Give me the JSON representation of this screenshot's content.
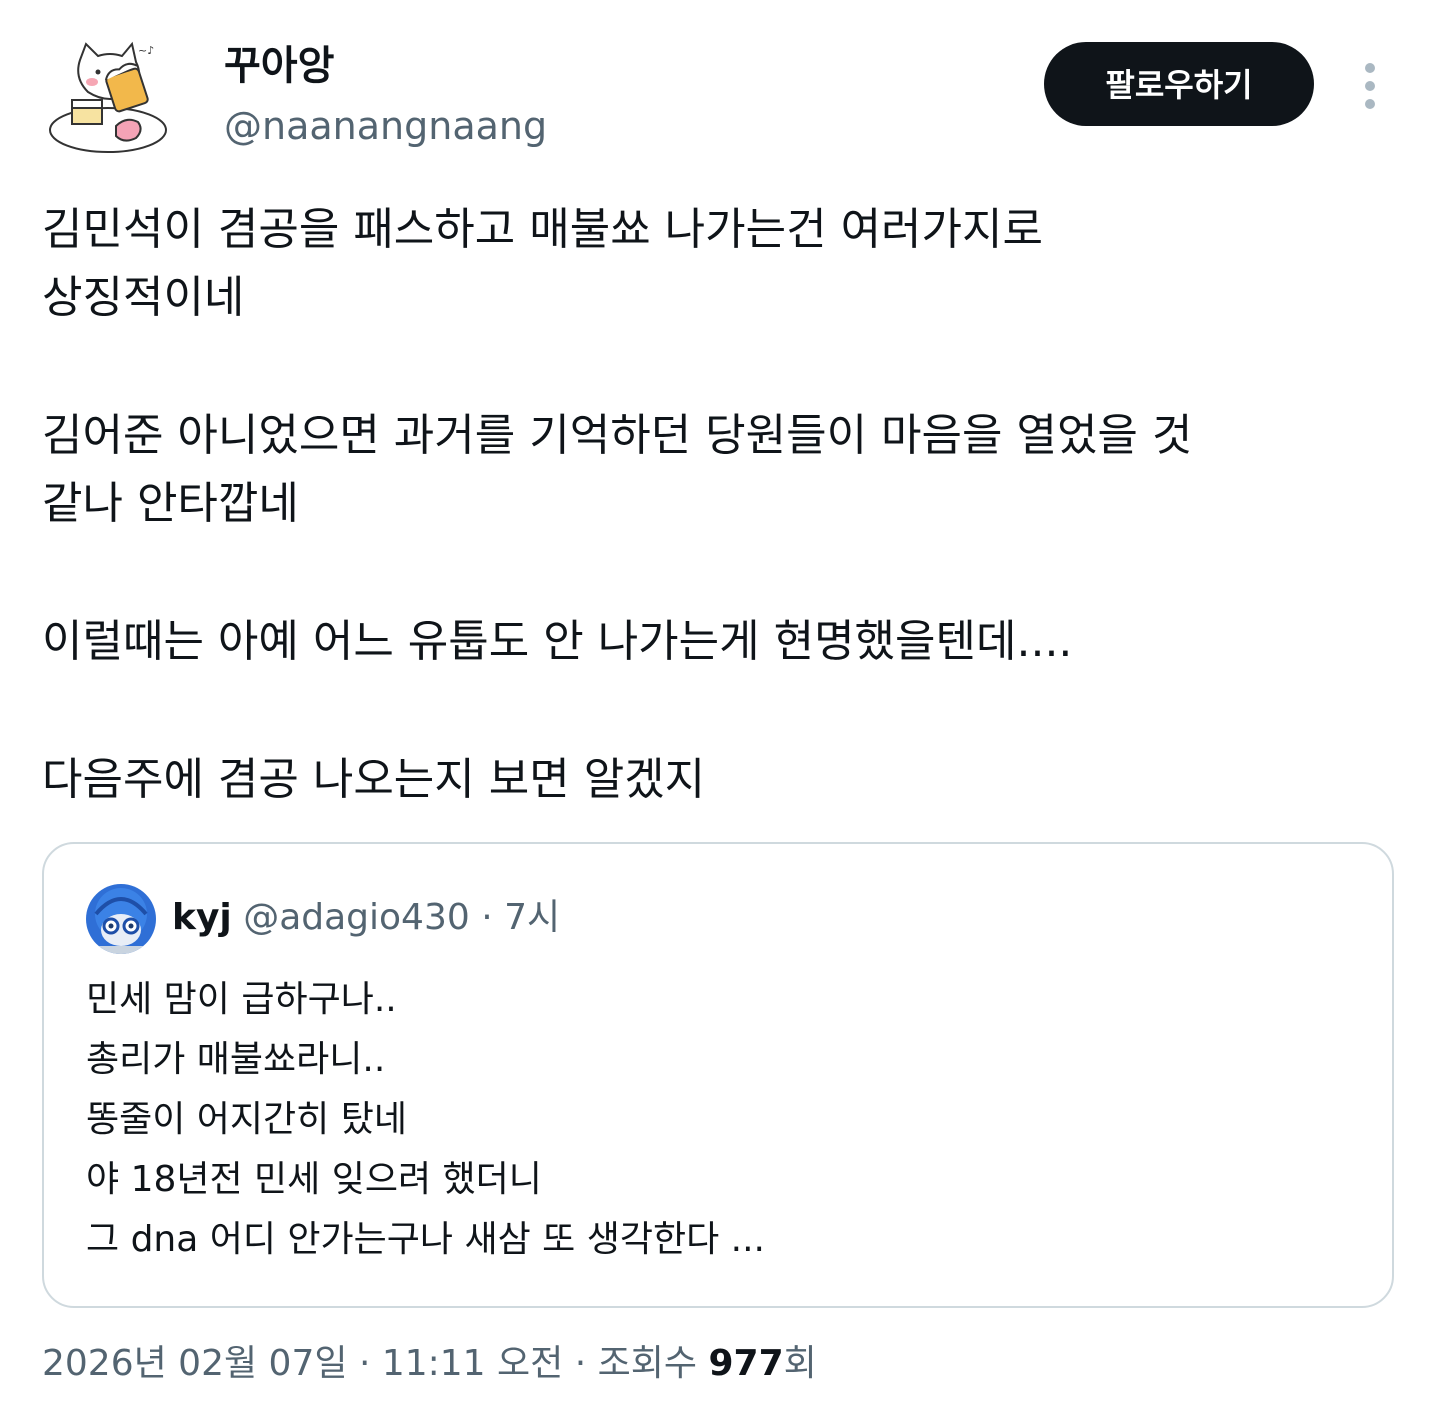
{
  "author": {
    "display_name": "꾸아앙",
    "handle": "@naanangnaang"
  },
  "header": {
    "follow_label": "팔로우하기",
    "more_icon": "more-vertical-icon"
  },
  "tweet": {
    "paragraphs": [
      [
        "김민석이 겸공을 패스하고 매불쑈 나가는건 여러가지로",
        "상징적이네"
      ],
      [
        "김어준 아니었으면 과거를 기억하던 당원들이 마음을 열었을 것",
        "같나 안타깝네"
      ],
      [
        "이럴때는 아예 어느 유툽도 안 나가는게 현명했을텐데...."
      ],
      [
        "다음주에 겸공 나오는지 보면 알겠지"
      ]
    ]
  },
  "quote": {
    "name": "kyj",
    "handle": "@adagio430",
    "separator": "·",
    "time": "7시",
    "lines": [
      "민세  맘이 급하구나..",
      "총리가  매불쑈라니..",
      "똥줄이 어지간히 탔네",
      "야  18년전 민세 잊으려 했더니",
      "그 dna 어디 안가는구나 새삼 또 생각한다 ..."
    ]
  },
  "meta": {
    "date": "2026년 02월 07일",
    "separator": "·",
    "time": "11:11 오전",
    "views_label": "조회수",
    "views_count": "977",
    "views_suffix": "회"
  },
  "colors": {
    "text": "#0f1419",
    "secondary": "#536471",
    "border": "#cfd9de",
    "button_bg": "#0f1419",
    "button_text": "#ffffff"
  }
}
